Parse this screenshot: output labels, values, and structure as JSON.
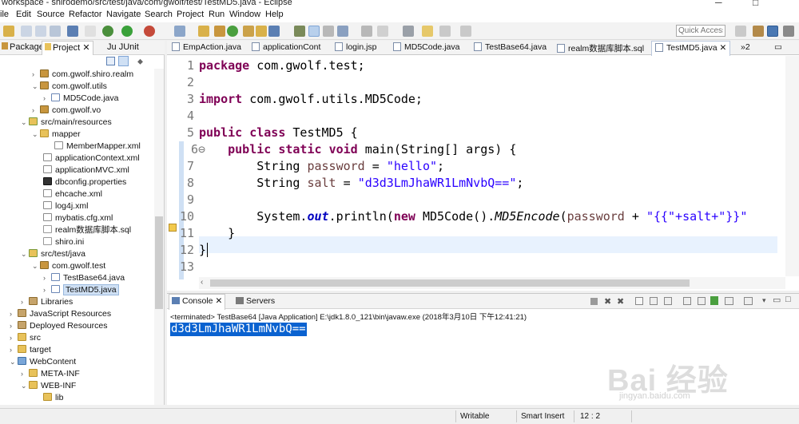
{
  "window": {
    "title": "workspace - shirodemo/src/test/java/com/gwolf/test/TestMD5.java - Eclipse",
    "minimize": "─",
    "maximize": "□"
  },
  "menu": [
    "ile",
    "Edit",
    "Source",
    "Refactor",
    "Navigate",
    "Search",
    "Project",
    "Run",
    "Window",
    "Help"
  ],
  "toolbar": {
    "quick_access": "Quick Access"
  },
  "explorer": {
    "tabs": [
      "Package",
      "Project",
      "JUnit"
    ],
    "tab_prefix": "Ju",
    "items": [
      {
        "label": "com.gwolf.shiro.realm",
        "icon": "package-icon"
      },
      {
        "label": "com.gwolf.utils",
        "icon": "package-icon"
      },
      {
        "label": "MD5Code.java",
        "icon": "java-file-icon"
      },
      {
        "label": "com.gwolf.vo",
        "icon": "package-icon"
      },
      {
        "label": "src/main/resources",
        "icon": "source-folder-icon"
      },
      {
        "label": "mapper",
        "icon": "folder-icon"
      },
      {
        "label": "MemberMapper.xml",
        "icon": "xml-file-icon"
      },
      {
        "label": "applicationContext.xml",
        "icon": "xml-file-icon"
      },
      {
        "label": "applicationMVC.xml",
        "icon": "xml-file-icon"
      },
      {
        "label": "dbconfig.properties",
        "icon": "properties-file-icon"
      },
      {
        "label": "ehcache.xml",
        "icon": "xml-file-icon"
      },
      {
        "label": "log4j.xml",
        "icon": "xml-file-icon"
      },
      {
        "label": "mybatis.cfg.xml",
        "icon": "xml-file-icon"
      },
      {
        "label": "realm数据库脚本.sql",
        "icon": "sql-file-icon"
      },
      {
        "label": "shiro.ini",
        "icon": "file-icon"
      },
      {
        "label": "src/test/java",
        "icon": "source-folder-icon"
      },
      {
        "label": "com.gwolf.test",
        "icon": "package-icon"
      },
      {
        "label": "TestBase64.java",
        "icon": "java-file-icon"
      },
      {
        "label": "TestMD5.java",
        "icon": "java-file-icon"
      },
      {
        "label": "Libraries",
        "icon": "library-icon"
      },
      {
        "label": "JavaScript Resources",
        "icon": "library-icon"
      },
      {
        "label": "Deployed Resources",
        "icon": "library-icon"
      },
      {
        "label": "src",
        "icon": "folder-icon"
      },
      {
        "label": "target",
        "icon": "folder-icon"
      },
      {
        "label": "WebContent",
        "icon": "web-folder-icon"
      },
      {
        "label": "META-INF",
        "icon": "folder-icon"
      },
      {
        "label": "WEB-INF",
        "icon": "folder-icon"
      },
      {
        "label": "lib",
        "icon": "folder-icon"
      }
    ]
  },
  "editor": {
    "tabs": [
      "EmpAction.java",
      "applicationCont",
      "login.jsp",
      "MD5Code.java",
      "TestBase64.java",
      "realm数据库脚本.sql",
      "TestMD5.java"
    ],
    "overflow": "»2",
    "active_tab": "TestMD5.java",
    "line_numbers": [
      "1",
      "2",
      "3",
      "4",
      "5",
      "6⊖",
      "7",
      "8",
      "9",
      "10",
      "11",
      "12",
      "13"
    ],
    "code": {
      "l1_kw": "package",
      "l1_rest": " com.gwolf.test;",
      "l3_kw": "import",
      "l3_rest": " com.gwolf.utils.MD5Code;",
      "l5_kw1": "public",
      "l5_kw2": "class",
      "l5_rest": " TestMD5 {",
      "l6_kw1": "public",
      "l6_kw2": "static",
      "l6_kw3": "void",
      "l6_rest": " main(String[] args) {",
      "l7_type": "String ",
      "l7_var": "password",
      "l7_eq": " = ",
      "l7_str": "\"hello\"",
      "l7_end": ";",
      "l8_type": "String ",
      "l8_var": "salt",
      "l8_eq": " = ",
      "l8_str": "\"d3d3LmJhaWR1LmNvbQ==\"",
      "l8_end": ";",
      "l10_sys": "System.",
      "l10_out": "out",
      "l10_print": ".println(",
      "l10_new": "new",
      "l10_cls": " MD5Code().",
      "l10_mth": "MD5Encode",
      "l10_paren": "(",
      "l10_var": "password",
      "l10_plus": " + ",
      "l10_str": "\"{{\"+salt+\"}}\"",
      "l11": "}",
      "l12": "}"
    }
  },
  "console": {
    "tabs": [
      "Console",
      "Servers"
    ],
    "status": "<terminated> TestBase64 [Java Application] E:\\jdk1.8.0_121\\bin\\javaw.exe (2018年3月10日 下午12:41:21)",
    "output": "d3d3LmJhaWR1LmNvbQ=="
  },
  "statusbar": {
    "writable": "Writable",
    "insert_mode": "Smart Insert",
    "position": "12 : 2"
  },
  "watermark": {
    "logo": "Bai 经验",
    "url": "jingyan.baidu.com"
  }
}
